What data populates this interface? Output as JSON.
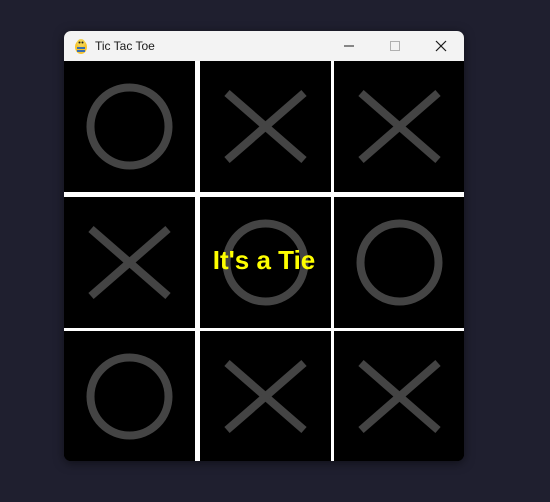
{
  "window": {
    "title": "Tic Tac Toe",
    "icon": "pygame-snake-icon"
  },
  "controls": {
    "minimize_icon": "minimize-icon",
    "maximize_icon": "maximize-icon",
    "close_icon": "close-icon"
  },
  "board": {
    "cells": [
      "O",
      "X",
      "X",
      "X",
      "O",
      "O",
      "O",
      "X",
      "X"
    ],
    "mark_color": "#444444",
    "grid_color": "#ffffff",
    "background": "#000000"
  },
  "status": {
    "message": "It's a Tie",
    "color": "#ffff00"
  }
}
